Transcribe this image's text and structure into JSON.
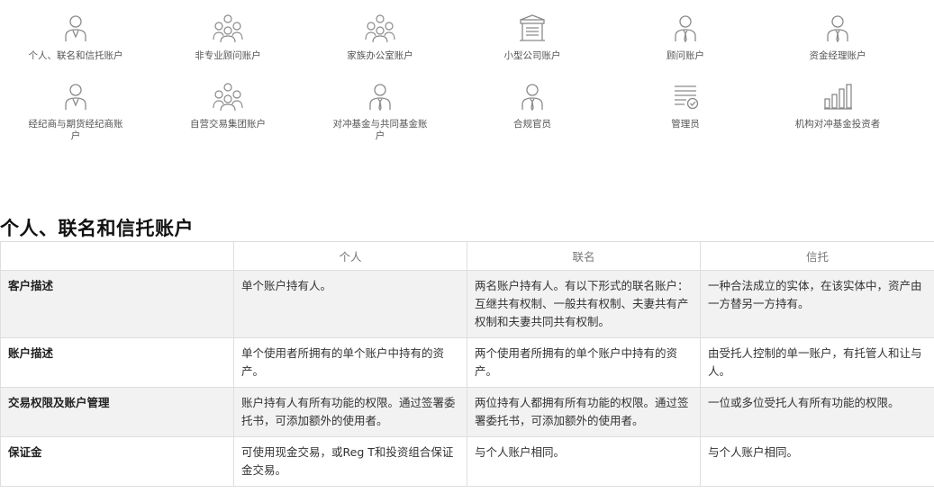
{
  "account_types": [
    {
      "label": "个人、联名和信托账户",
      "icon": "person-icon"
    },
    {
      "label": "非专业顾问账户",
      "icon": "group-icon"
    },
    {
      "label": "家族办公室账户",
      "icon": "group-icon"
    },
    {
      "label": "小型公司账户",
      "icon": "building-icon"
    },
    {
      "label": "顾问账户",
      "icon": "person-icon"
    },
    {
      "label": "资金经理账户",
      "icon": "person-icon"
    },
    {
      "label": "经纪商与期货经纪商账户",
      "icon": "person-icon"
    },
    {
      "label": "自营交易集团账户",
      "icon": "group-icon"
    },
    {
      "label": "对冲基金与共同基金账户",
      "icon": "person-icon"
    },
    {
      "label": "合规官员",
      "icon": "person-icon"
    },
    {
      "label": "管理员",
      "icon": "document-check-icon"
    },
    {
      "label": "机构对冲基金投资者",
      "icon": "bar-chart-icon"
    }
  ],
  "section": {
    "title": "个人、联名和信托账户"
  },
  "table": {
    "headers": [
      "",
      "个人",
      "联名",
      "信托"
    ],
    "rows": [
      {
        "label": "客户描述",
        "cells": [
          "单个账户持有人。",
          "两名账户持有人。有以下形式的联名账户：互继共有权制、一般共有权制、夫妻共有产权制和夫妻共同共有权制。",
          "一种合法成立的实体，在该实体中，资产由一方替另一方持有。"
        ]
      },
      {
        "label": "账户描述",
        "cells": [
          "单个使用者所拥有的单个账户中持有的资产。",
          "两个使用者所拥有的单个账户中持有的资产。",
          "由受托人控制的单一账户，有托管人和让与人。"
        ]
      },
      {
        "label": "交易权限及账户管理",
        "cells": [
          "账户持有人有所有功能的权限。通过签署委托书，可添加额外的使用者。",
          "两位持有人都拥有所有功能的权限。通过签署委托书，可添加额外的使用者。",
          "一位或多位受托人有所有功能的权限。"
        ]
      },
      {
        "label": "保证金",
        "cells": [
          "可使用现金交易，或Reg T和投资组合保证金交易。",
          "与个人账户相同。",
          "与个人账户相同。"
        ]
      }
    ]
  },
  "colors": {
    "icon_stroke": "#8a8a8a",
    "row_shade": "#f1f2f1",
    "border": "#dedede"
  }
}
